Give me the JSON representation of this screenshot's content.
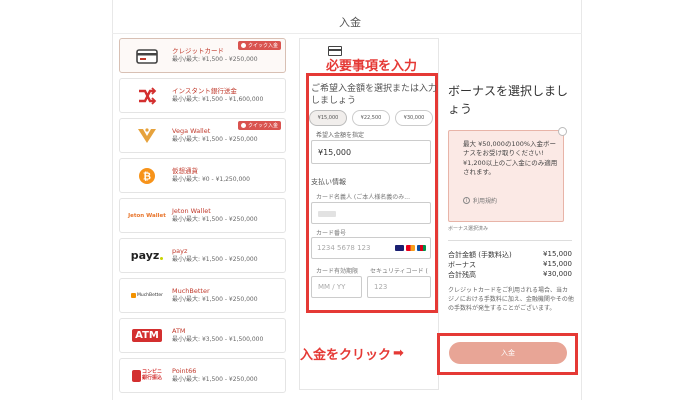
{
  "page": {
    "title": "入金"
  },
  "payment_methods": [
    {
      "name": "クレジットカード",
      "range": "最小/最大: ¥1,500 - ¥250,000",
      "badge": "クイック入金",
      "icon": "credit-card-icon",
      "selected": true
    },
    {
      "name": "インスタント銀行送金",
      "range": "最小/最大: ¥1,500 - ¥1,600,000",
      "badge": "",
      "icon": "instant-bank-icon",
      "selected": false
    },
    {
      "name": "Vega Wallet",
      "range": "最小/最大: ¥1,500 - ¥250,000",
      "badge": "クイック入金",
      "icon": "vega-wallet-icon",
      "selected": false
    },
    {
      "name": "仮想通貨",
      "range": "最小/最大: ¥0 - ¥1,250,000",
      "badge": "",
      "icon": "bitcoin-icon",
      "selected": false
    },
    {
      "name": "Jeton Wallet",
      "range": "最小/最大: ¥1,500 - ¥250,000",
      "badge": "",
      "icon": "jeton-icon",
      "selected": false
    },
    {
      "name": "payz",
      "range": "最小/最大: ¥1,500 - ¥250,000",
      "badge": "",
      "icon": "payz-icon",
      "selected": false
    },
    {
      "name": "MuchBetter",
      "range": "最小/最大: ¥1,500 - ¥250,000",
      "badge": "",
      "icon": "muchbetter-icon",
      "selected": false
    },
    {
      "name": "ATM",
      "range": "最小/最大: ¥3,500 - ¥1,500,000",
      "badge": "",
      "icon": "atm-icon",
      "selected": false
    },
    {
      "name": "Point66",
      "range": "最小/最大: ¥1,500 - ¥250,000",
      "badge": "",
      "icon": "point66-icon",
      "selected": false
    }
  ],
  "logos": {
    "jeton": "Jeton Wallet",
    "payz": "payz",
    "muchbetter": "MuchBetter",
    "atm": "ATM",
    "point66_top": "コンビニ",
    "point66_bottom": "銀行振込"
  },
  "form": {
    "amount_label": "ご希望入金額を選択または入力しましょう",
    "chips": [
      "¥15,000",
      "¥22,500",
      "¥30,000"
    ],
    "active_chip": 0,
    "custom_label": "希望入金額を指定",
    "amount_value": "¥15,000",
    "payment_info_label": "支払い情報",
    "holder_label": "カード名義人 (ご本人様名義のみ...",
    "card_number_label": "カード番号",
    "card_number_placeholder": "1234 5678 123",
    "expiry_label": "カード有効期限",
    "expiry_placeholder": "MM / YY",
    "cvc_label": "セキュリティコード (",
    "cvc_placeholder": "123"
  },
  "bonus": {
    "title": "ボーナスを選択しましょう",
    "line1": "最大 ¥50,000の100%入金ボーナスをお受け取りください!",
    "line2": "¥1,200以上のご入金にのみ適用されます。",
    "terms_label": "利用規約",
    "note": "ボーナス選択済み"
  },
  "summary": {
    "rows": [
      {
        "label": "合計金額 (手数料込)",
        "value": "¥15,000"
      },
      {
        "label": "ボーナス",
        "value": "¥15,000"
      },
      {
        "label": "合計残高",
        "value": "¥30,000"
      }
    ],
    "disclaimer": "クレジットカードをご利用される場合、当カジノにおける手数料に加え、金融機関やその他の手数料が発生することがございます。"
  },
  "actions": {
    "deposit_label": "入金"
  },
  "annotations": {
    "fill_required": "必要事項を入力",
    "click_deposit": "入金をクリック",
    "arrow": "⬅"
  },
  "colors": {
    "annotation_red": "#e53935",
    "button_pink": "#e8a596",
    "bonus_bg": "#fbe9e5",
    "method_red": "#c0392b"
  }
}
